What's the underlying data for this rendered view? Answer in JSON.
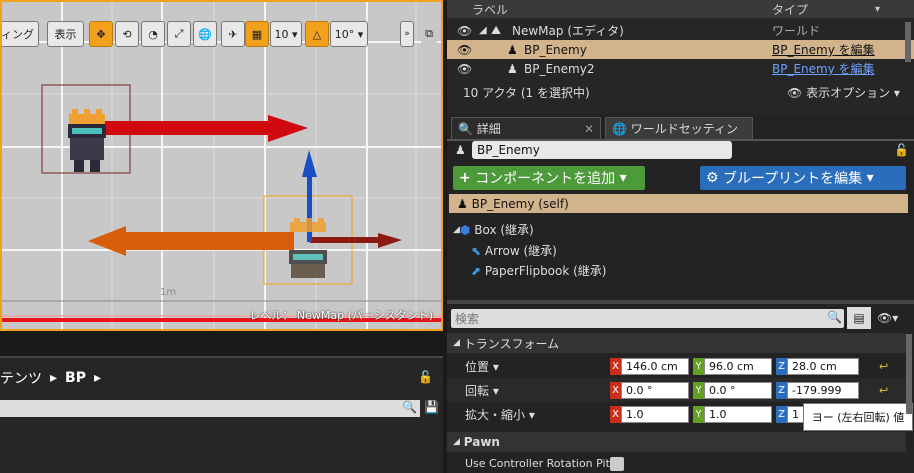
{
  "viewport": {
    "toolbar": {
      "lighting_label": "ィング",
      "show_label": "表示",
      "grid_snap_value": "10",
      "rot_snap_value": "10°"
    },
    "level_label": "レベル： NewMap (パーシスタント)",
    "scale_label": "1m"
  },
  "outliner": {
    "col_label": "ラベル",
    "col_type": "タイプ",
    "rows": [
      {
        "name": "NewMap (エディタ)",
        "type": "ワールド"
      },
      {
        "name": "BP_Enemy",
        "type": "BP_Enemy を編集"
      },
      {
        "name": "BP_Enemy2",
        "type": "BP_Enemy を編集"
      }
    ],
    "status": "10 アクタ (1 を選択中)",
    "view_options": "表示オプション"
  },
  "details": {
    "tab_details": "詳細",
    "tab_world": "ワールドセッティン",
    "actor_name": "BP_Enemy",
    "add_component": "コンポーネントを追加",
    "edit_blueprint": "ブループリントを編集",
    "self_label": "BP_Enemy (self)",
    "components": [
      {
        "label": "Box (継承)",
        "icon": "box-icon"
      },
      {
        "label": "Arrow (継承)",
        "icon": "arrow-icon"
      },
      {
        "label": "PaperFlipbook (継承)",
        "icon": "flipbook-icon"
      }
    ],
    "search_placeholder": "検索",
    "transform_header": "トランスフォーム",
    "location_label": "位置",
    "rotation_label": "回転",
    "scale_label": "拡大・縮小",
    "location": {
      "x": "146.0 cm",
      "y": "96.0 cm",
      "z": "28.0 cm"
    },
    "rotation": {
      "x": "0.0 °",
      "y": "0.0 °",
      "z": "-179.999"
    },
    "scale": {
      "x": "1.0",
      "y": "1.0",
      "z": "1"
    },
    "tooltip": "ヨー (左右回転) 値",
    "pawn_header": "Pawn",
    "use_controller_label": "Use Controller Rotation Pitc"
  },
  "content_browser": {
    "breadcrumb_part": "テンツ",
    "breadcrumb_bp": "BP"
  }
}
